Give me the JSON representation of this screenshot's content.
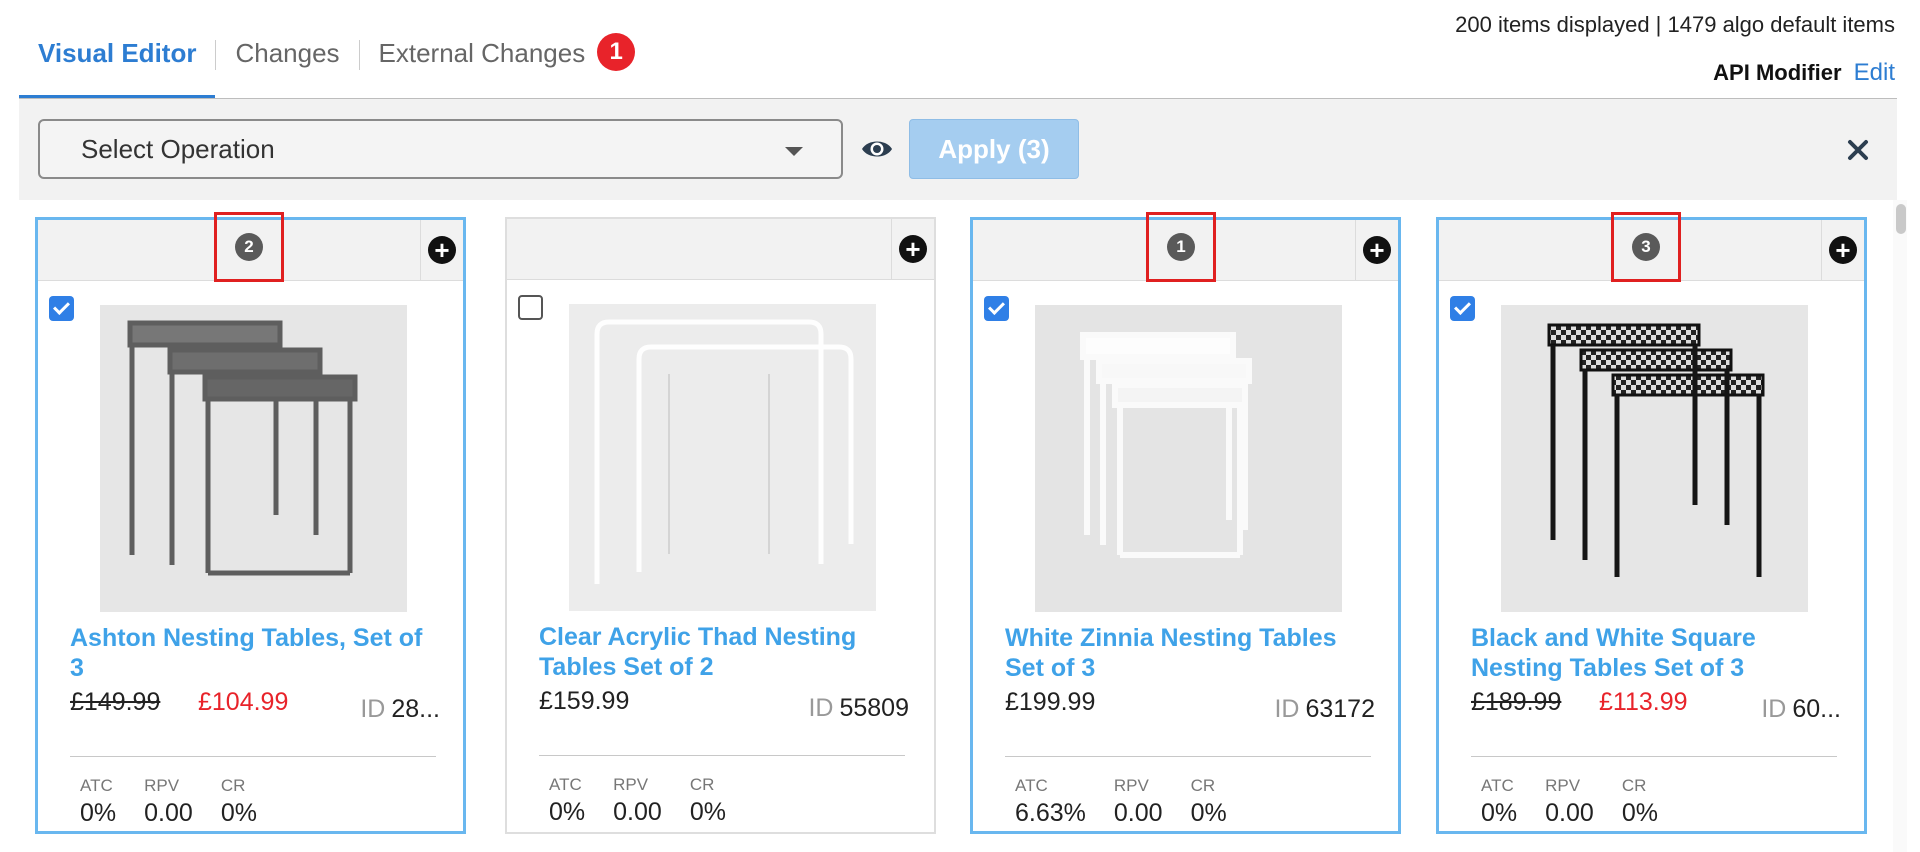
{
  "tabs": [
    {
      "label": "Visual Editor",
      "active": true
    },
    {
      "label": "Changes",
      "active": false
    },
    {
      "label": "External Changes",
      "active": false,
      "badge": "1"
    }
  ],
  "header": {
    "count_text": "200 items displayed | 1479 algo default items",
    "api_label": "API Modifier",
    "api_edit": "Edit"
  },
  "toolbar": {
    "select_placeholder": "Select Operation",
    "apply_label": "Apply (3)",
    "eye_icon": "eye-icon",
    "close_icon": "close-icon"
  },
  "colors": {
    "accent": "#2d7dd2",
    "title_link": "#3fa2e8",
    "sale": "#e8232a",
    "selected_border": "#69b7ef",
    "rank_highlight": "#e02020",
    "apply_disabled": "#a5cdf0"
  },
  "products": [
    {
      "rank": "2",
      "selected": true,
      "title": "Ashton Nesting Tables, Set of 3",
      "old_price": "£149.99",
      "price": "£104.99",
      "id_label": "ID",
      "id_value": "28...",
      "metrics": [
        {
          "label": "ATC",
          "value": "0%"
        },
        {
          "label": "RPV",
          "value": "0.00"
        },
        {
          "label": "CR",
          "value": "0%"
        }
      ]
    },
    {
      "rank": "",
      "selected": false,
      "title": "Clear Acrylic Thad Nesting Tables Set of 2",
      "old_price": "",
      "price": "£159.99",
      "id_label": "ID",
      "id_value": "55809",
      "metrics": [
        {
          "label": "ATC",
          "value": "0%"
        },
        {
          "label": "RPV",
          "value": "0.00"
        },
        {
          "label": "CR",
          "value": "0%"
        }
      ]
    },
    {
      "rank": "1",
      "selected": true,
      "title": "White Zinnia Nesting Tables Set of 3",
      "old_price": "",
      "price": "£199.99",
      "id_label": "ID",
      "id_value": "63172",
      "metrics": [
        {
          "label": "ATC",
          "value": "6.63%"
        },
        {
          "label": "RPV",
          "value": "0.00"
        },
        {
          "label": "CR",
          "value": "0%"
        }
      ]
    },
    {
      "rank": "3",
      "selected": true,
      "title": "Black and White Square Nesting Tables Set of 3",
      "old_price": "£189.99",
      "price": "£113.99",
      "id_label": "ID",
      "id_value": "60...",
      "metrics": [
        {
          "label": "ATC",
          "value": "0%"
        },
        {
          "label": "RPV",
          "value": "0.00"
        },
        {
          "label": "CR",
          "value": "0%"
        }
      ]
    }
  ]
}
